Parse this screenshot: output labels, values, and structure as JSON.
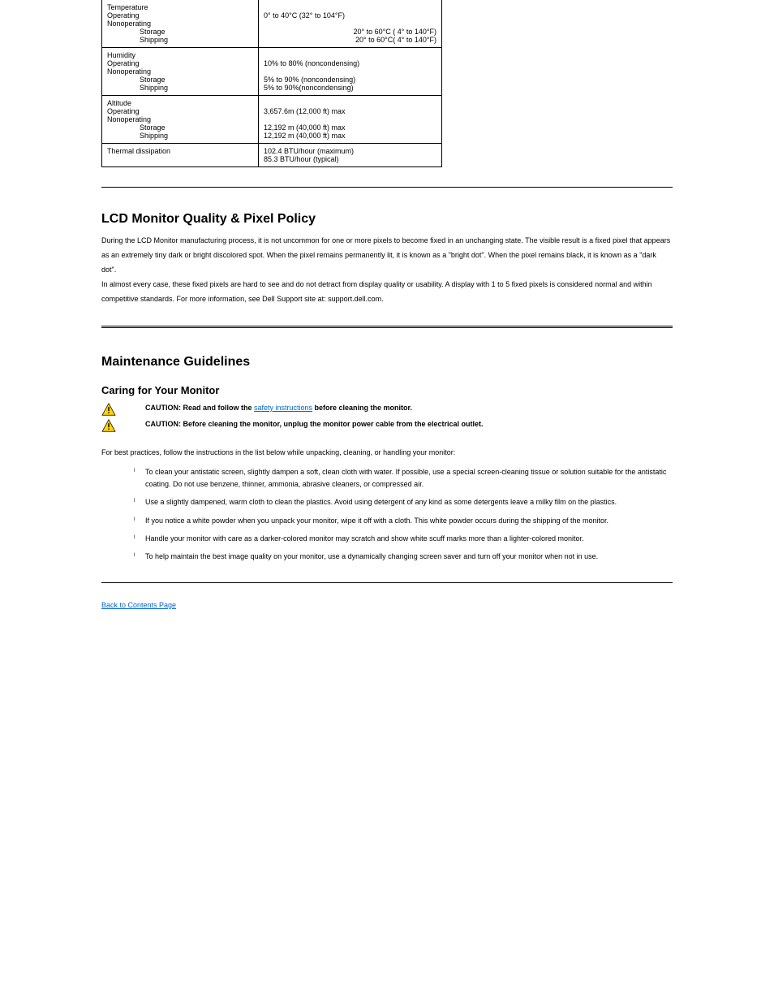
{
  "spec_table": {
    "rows": [
      {
        "label_lines": [
          "Temperature",
          "Operating",
          "Nonoperating",
          "    Storage",
          "    Shipping"
        ],
        "value_lines": [
          "",
          "0° to 40°C (32° to 104°F)",
          "",
          "20° to 60°C ( 4° to 140°F)",
          "20° to 60°C( 4° to 140°F)"
        ],
        "value_right_align": [
          false,
          false,
          false,
          true,
          true
        ]
      },
      {
        "label_lines": [
          "Humidity",
          "Operating",
          "Nonoperating",
          "    Storage",
          "    Shipping"
        ],
        "value_lines": [
          "",
          "10% to 80% (noncondensing)",
          "",
          "5% to 90% (noncondensing)",
          "   5% to 90%(noncondensing)"
        ],
        "value_right_align": [
          false,
          false,
          false,
          false,
          false
        ]
      },
      {
        "label_lines": [
          "Altitude",
          "Operating",
          "Nonoperating",
          "    Storage",
          "    Shipping"
        ],
        "value_lines": [
          "",
          "3,657.6m (12,000 ft) max",
          "",
          "12,192 m (40,000 ft) max",
          "   12,192 m (40,000 ft) max"
        ],
        "value_right_align": [
          false,
          false,
          false,
          false,
          false
        ]
      },
      {
        "label_lines": [
          "Thermal dissipation"
        ],
        "value_lines": [
          "102.4 BTU/hour (maximum)",
          "85.3 BTU/hour (typical)"
        ],
        "value_right_align": [
          false,
          false
        ]
      }
    ]
  },
  "policy": {
    "heading": "LCD Monitor Quality & Pixel Policy",
    "body": "During the LCD Monitor manufacturing process, it is not uncommon for one or more pixels to become fixed in an unchanging state. The visible result is a fixed pixel that appears as an extremely tiny dark or bright discolored spot. When the pixel remains permanently lit, it is known as a \"bright dot\". When the pixel remains black, it is known as a \"dark dot\".\nIn almost every case, these fixed pixels are hard to see and do not detract from display quality or usability. A display with 1 to 5 fixed pixels is considered normal and within competitive standards.  For more information, see Dell Support site at: support.dell.com."
  },
  "maintenance": {
    "heading": "Maintenance Guidelines",
    "sub": "Caring for Your Monitor",
    "warn1_prefix": "CAUTION: Read and follow the ",
    "warn1_link": "safety instructions",
    "warn1_suffix": " before cleaning the monitor.",
    "warn2": "CAUTION: Before cleaning the monitor, unplug the monitor power cable from the electrical outlet.",
    "intro": "For best practices, follow the instructions in the list below while unpacking, cleaning, or handling your monitor:",
    "bullets": [
      "To clean your antistatic screen, slightly dampen a soft, clean cloth with water. If possible, use a special screen-cleaning tissue or solution suitable for the antistatic coating. Do not use benzene, thinner, ammonia, abrasive cleaners, or compressed air.",
      "Use a slightly dampened, warm cloth to clean the plastics. Avoid using detergent of any kind as some detergents leave a milky film on the plastics.",
      "If you notice a white powder when you unpack your monitor, wipe it off with a cloth. This white powder occurs during the shipping of the monitor.",
      "Handle your monitor with care as a darker-colored monitor may scratch and show white scuff marks more than a lighter-colored monitor.",
      "To help maintain the best image quality on your monitor, use a dynamically changing screen saver and turn off your monitor when not in use."
    ]
  },
  "back": {
    "label": "Back to Contents Page"
  }
}
